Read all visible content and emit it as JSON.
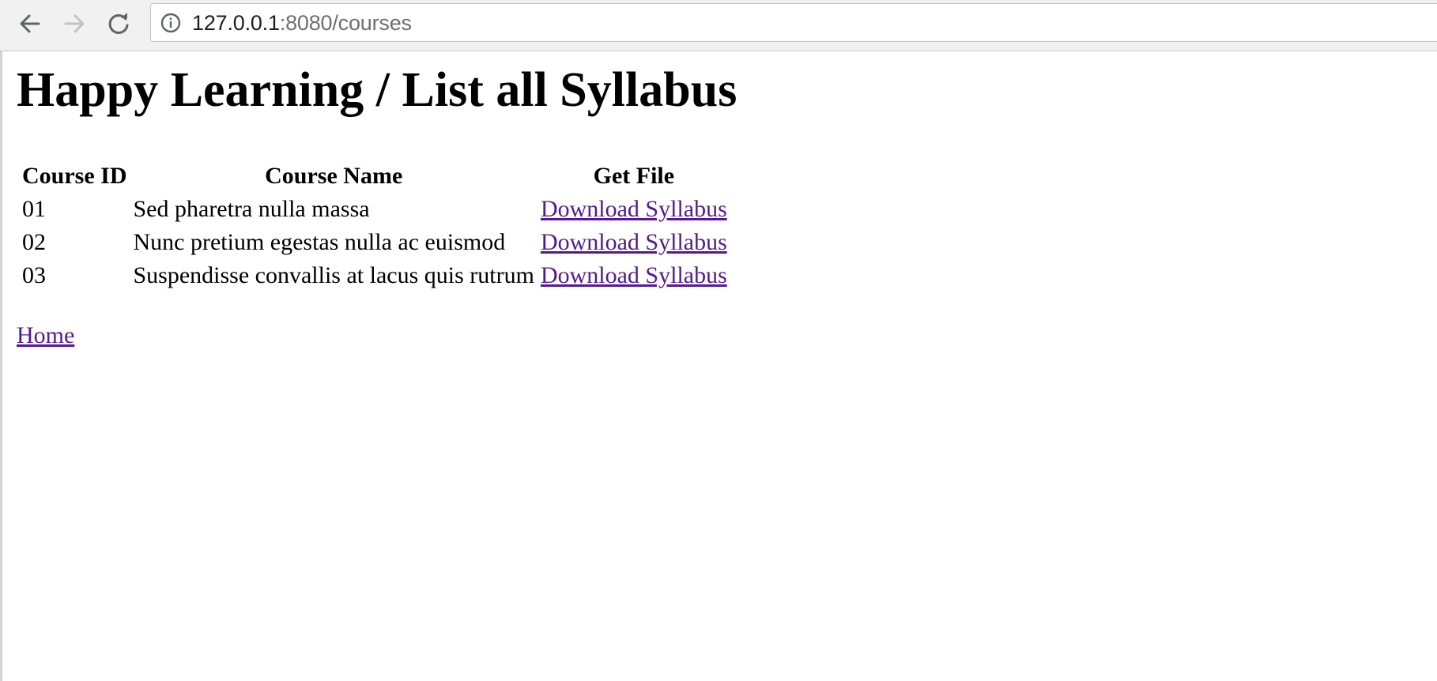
{
  "browser": {
    "url_host": "127.0.0.1",
    "url_rest": ":8080/courses",
    "icons": {
      "back": "arrow-left-icon",
      "forward": "arrow-right-icon",
      "reload": "reload-icon",
      "info": "info-circle-icon"
    }
  },
  "page": {
    "title": "Happy Learning / List all Syllabus",
    "table": {
      "headers": [
        "Course ID",
        "Course Name",
        "Get File"
      ],
      "rows": [
        {
          "id": "01",
          "name": "Sed pharetra nulla massa",
          "link": "Download Syllabus"
        },
        {
          "id": "02",
          "name": "Nunc pretium egestas nulla ac euismod",
          "link": "Download Syllabus"
        },
        {
          "id": "03",
          "name": "Suspendisse convallis at lacus quis rutrum",
          "link": "Download Syllabus"
        }
      ]
    },
    "home_link": "Home"
  },
  "colors": {
    "visited_link": "#551a8b",
    "toolbar_bg": "#f1f1f1"
  }
}
